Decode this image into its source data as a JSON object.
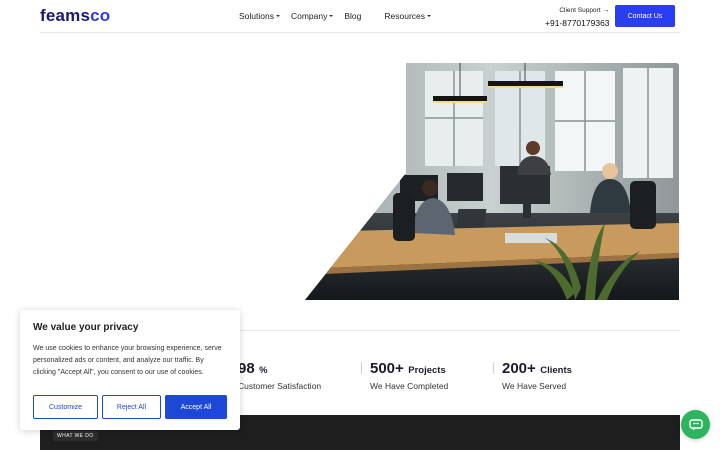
{
  "header": {
    "logo_prefix": "feams",
    "logo_suffix": "co",
    "nav": [
      {
        "label": "Solutions",
        "has_caret": true
      },
      {
        "label": "Company",
        "has_caret": true
      },
      {
        "label": "Blog",
        "has_caret": false
      },
      {
        "label": "Resources",
        "has_caret": true
      }
    ],
    "support_label": "Client Support",
    "support_phone": "+91-8770179363",
    "contact_label": "Contact Us"
  },
  "stats": [
    {
      "number": "98",
      "suffix": "%",
      "label": "Customer Satisfaction"
    },
    {
      "number": "500+",
      "suffix": "Projects",
      "label": "We Have Completed"
    },
    {
      "number": "200+",
      "suffix": "Clients",
      "label": "We Have Served"
    }
  ],
  "section": {
    "tag": "WHAT WE DO"
  },
  "cookie": {
    "title": "We value your privacy",
    "text": "We use cookies to enhance your browsing experience, serve personalized ads or content, and analyze our traffic. By clicking \"Accept All\", you consent to our use of cookies.",
    "customize": "Customize",
    "reject": "Reject All",
    "accept": "Accept All"
  },
  "icons": {
    "support_arrow": "arrow-right-icon",
    "chat": "chat-icon"
  },
  "colors": {
    "brand_blue": "#2a3df0",
    "cookie_blue": "#1d47d6",
    "chat_green": "#2eb35f",
    "dark_section": "#1e1e1e"
  }
}
